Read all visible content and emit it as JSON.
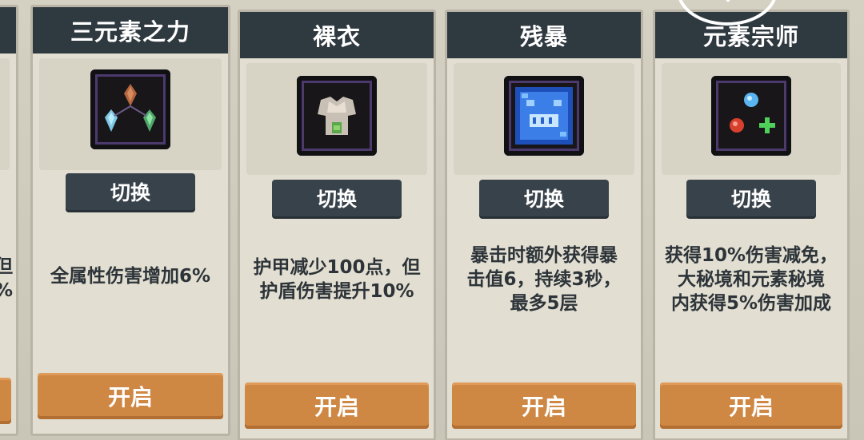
{
  "cards": [
    {
      "title": "",
      "switch_label": "",
      "description": "但\n%",
      "open_label": ""
    },
    {
      "title": "三元素之力",
      "icon": "three-gems-icon",
      "switch_label": "切换",
      "description": "全属性伤害增加6%",
      "open_label": "开启"
    },
    {
      "title": "裸衣",
      "icon": "bare-shirt-icon",
      "switch_label": "切换",
      "description": "护甲减少100点，但\n护盾伤害提升10%",
      "open_label": "开启"
    },
    {
      "title": "残暴",
      "icon": "blue-beast-icon",
      "switch_label": "切换",
      "description": "暴击时额外获得暴\n击值6，持续3秒，\n最多5层",
      "open_label": "开启"
    },
    {
      "title": "元素宗师",
      "icon": "three-element-orbs-icon",
      "switch_label": "切换",
      "description": "获得10%伤害减免，\n大秘境和元素秘境\n内获得5%伤害加成",
      "open_label": "开启"
    }
  ],
  "colors": {
    "title_bar": "#2f3940",
    "open_button": "#cf8744",
    "switch_button": "#38424a"
  }
}
